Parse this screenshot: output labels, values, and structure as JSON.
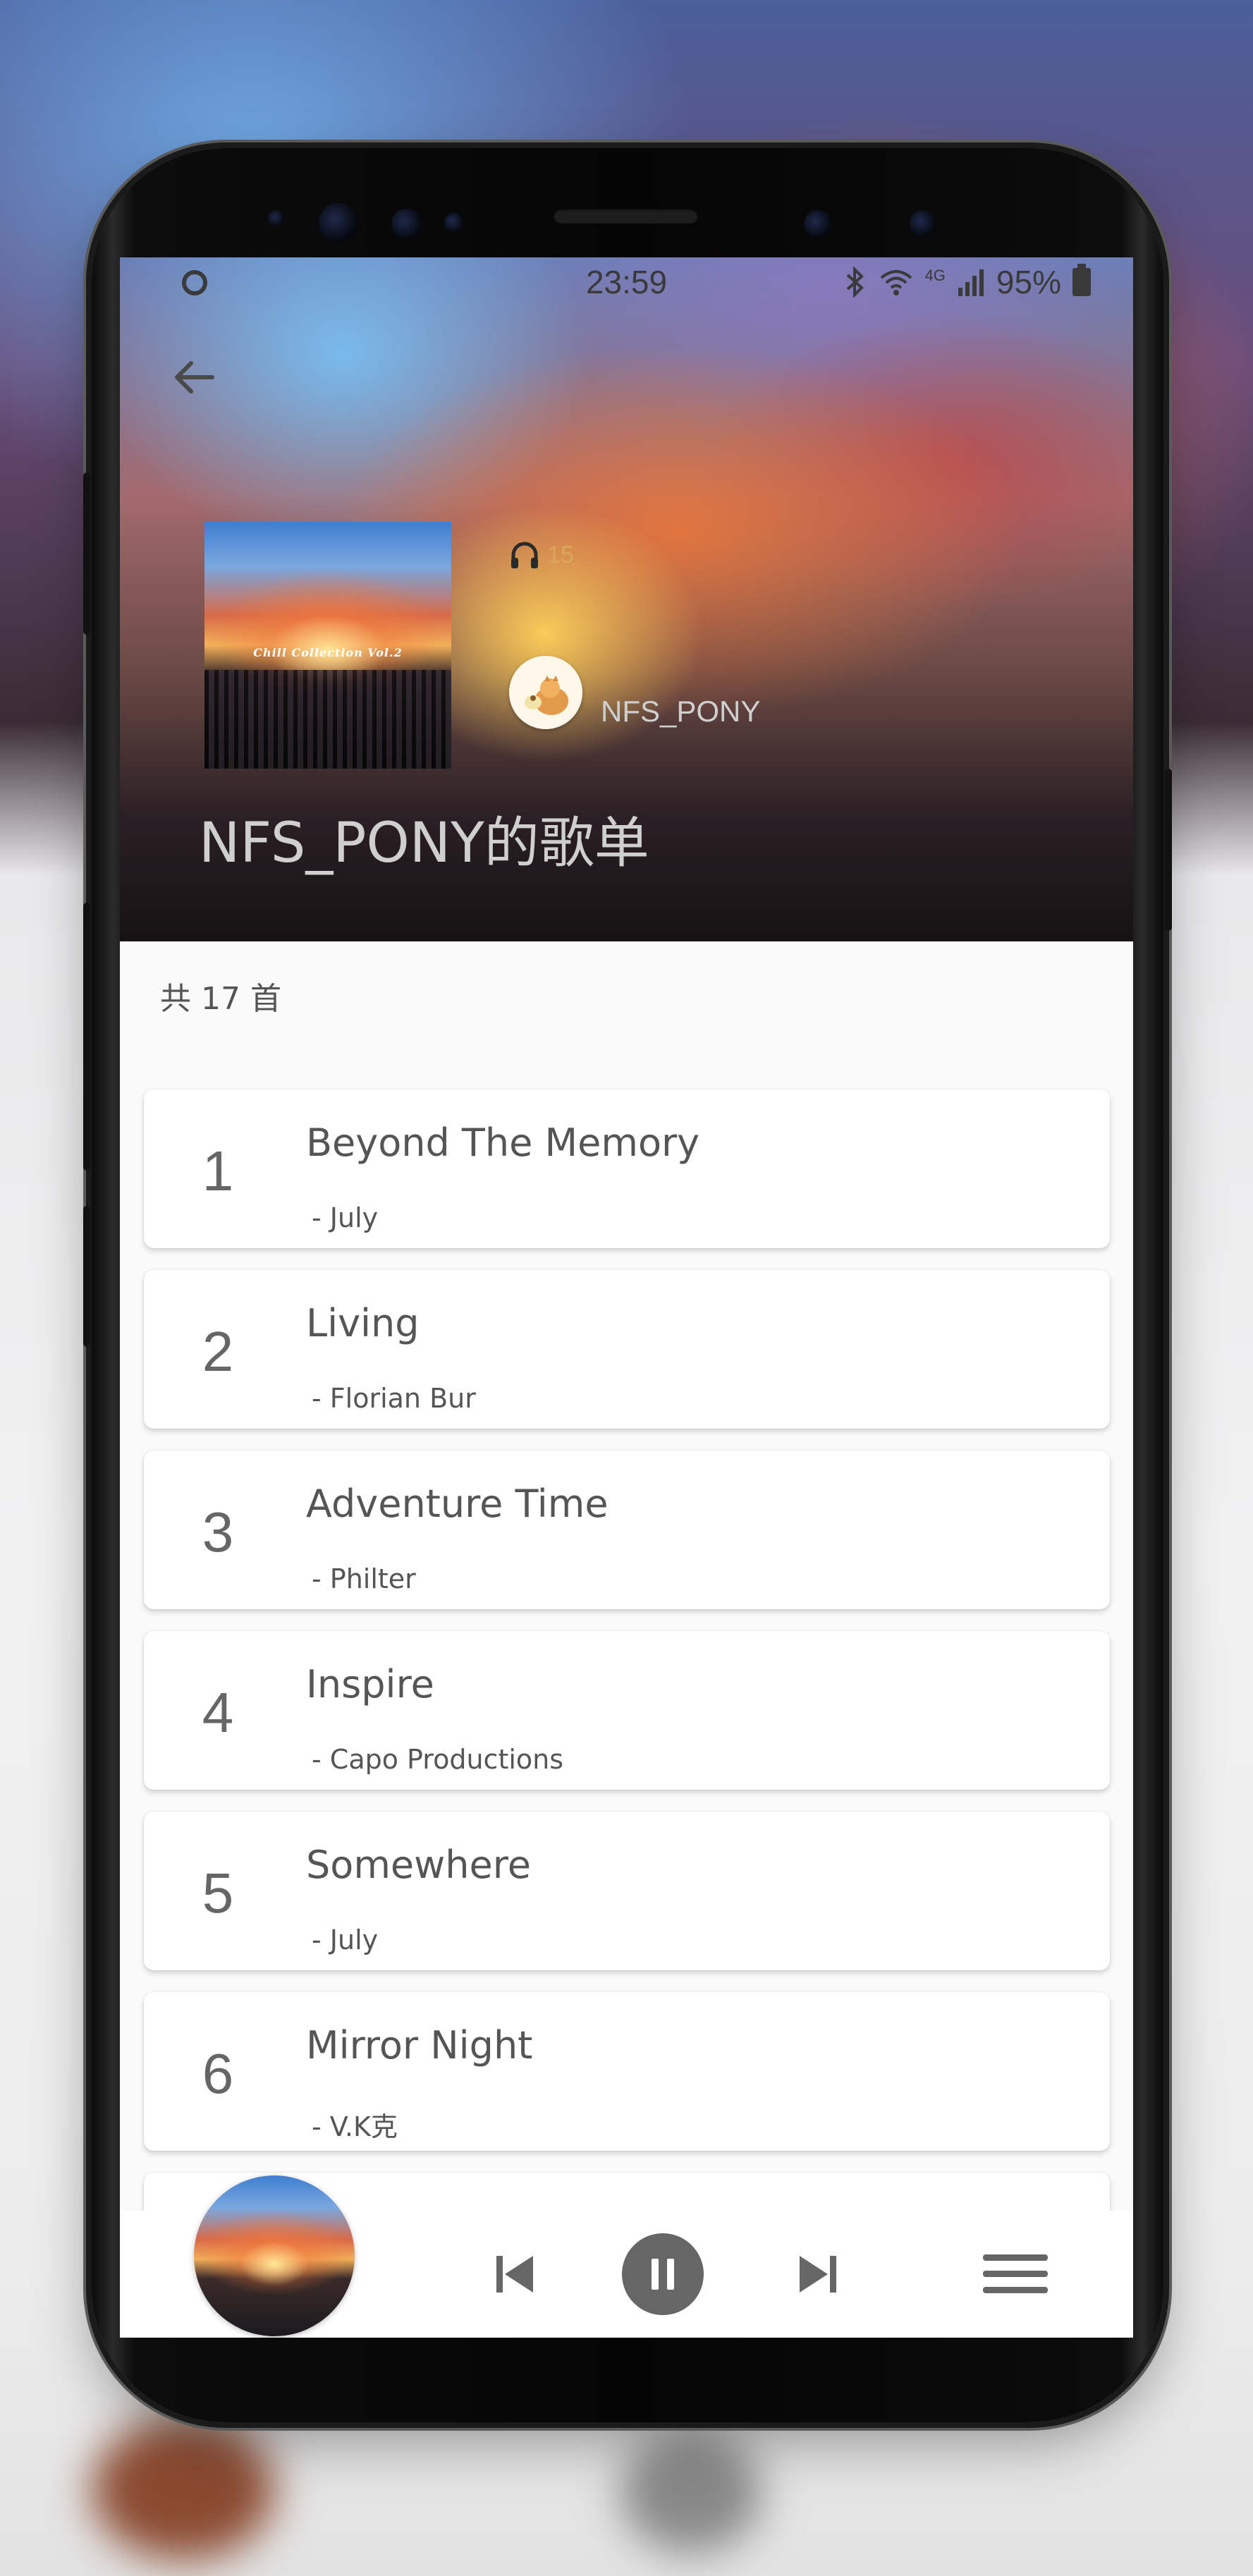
{
  "status_bar": {
    "time": "23:59",
    "network": "4G",
    "battery": "95%"
  },
  "header": {
    "plays": "15",
    "owner": "NFS_PONY",
    "title": "NFS_PONY的歌单",
    "cover_title": "Chill Collection Vol.2"
  },
  "playlist": {
    "count_label": "共 17 首",
    "songs": [
      {
        "index": "1",
        "name": "Beyond The Memory",
        "artist": "- July"
      },
      {
        "index": "2",
        "name": "Living",
        "artist": "- Florian Bur"
      },
      {
        "index": "3",
        "name": "Adventure Time",
        "artist": "- Philter"
      },
      {
        "index": "4",
        "name": "Inspire",
        "artist": "- Capo Productions"
      },
      {
        "index": "5",
        "name": "Somewhere",
        "artist": "- July"
      },
      {
        "index": "6",
        "name": "Mirror Night",
        "artist": "- V.K克"
      }
    ]
  },
  "player": {
    "state": "playing",
    "icons": [
      "previous-icon",
      "pause-icon",
      "next-icon",
      "menu-icon"
    ]
  },
  "colors": {
    "accent": "#d9a85a",
    "text": "#555555",
    "control": "#666666"
  }
}
